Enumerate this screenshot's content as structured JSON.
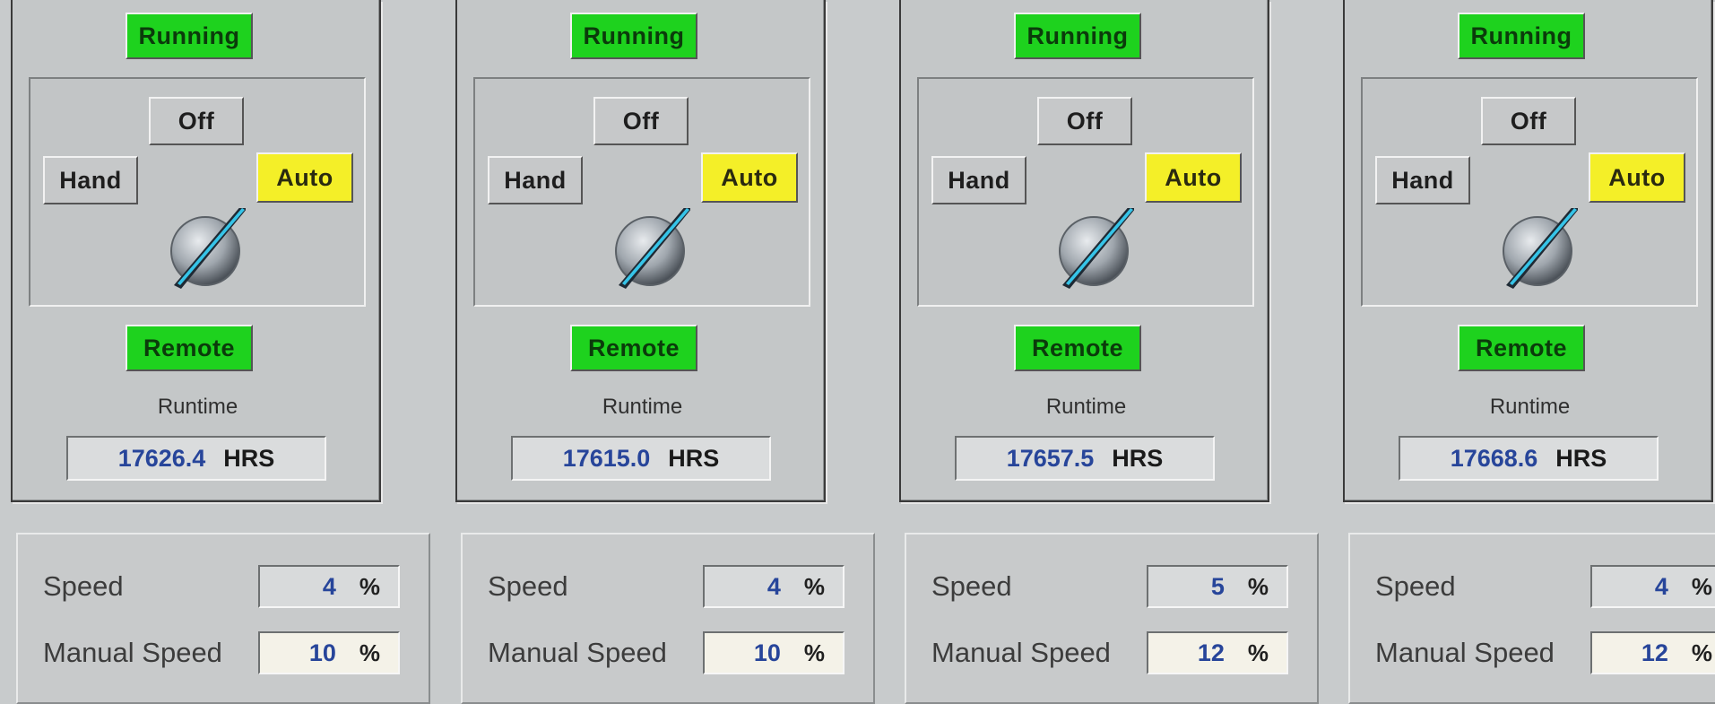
{
  "units": [
    {
      "status": "Running",
      "off": "Off",
      "hand": "Hand",
      "auto": "Auto",
      "remote": "Remote",
      "runtime_label": "Runtime",
      "runtime_value": "17626.4",
      "runtime_unit": "HRS",
      "speed_label": "Speed",
      "speed_value": "4",
      "speed_unit": "%",
      "manual_label": "Manual Speed",
      "manual_value": "10",
      "manual_unit": "%"
    },
    {
      "status": "Running",
      "off": "Off",
      "hand": "Hand",
      "auto": "Auto",
      "remote": "Remote",
      "runtime_label": "Runtime",
      "runtime_value": "17615.0",
      "runtime_unit": "HRS",
      "speed_label": "Speed",
      "speed_value": "4",
      "speed_unit": "%",
      "manual_label": "Manual Speed",
      "manual_value": "10",
      "manual_unit": "%"
    },
    {
      "status": "Running",
      "off": "Off",
      "hand": "Hand",
      "auto": "Auto",
      "remote": "Remote",
      "runtime_label": "Runtime",
      "runtime_value": "17657.5",
      "runtime_unit": "HRS",
      "speed_label": "Speed",
      "speed_value": "5",
      "speed_unit": "%",
      "manual_label": "Manual Speed",
      "manual_value": "12",
      "manual_unit": "%"
    },
    {
      "status": "Running",
      "off": "Off",
      "hand": "Hand",
      "auto": "Auto",
      "remote": "Remote",
      "runtime_label": "Runtime",
      "runtime_value": "17668.6",
      "runtime_unit": "HRS",
      "speed_label": "Speed",
      "speed_value": "4",
      "speed_unit": "%",
      "manual_label": "Manual Speed",
      "manual_value": "12",
      "manual_unit": "%"
    }
  ],
  "selected_mode": "Auto",
  "colors": {
    "running": "#1ed21e",
    "remote": "#1ed21e",
    "auto_selected": "#f4ef28",
    "value_text": "#27459a"
  },
  "icons": {
    "selector": "hand-off-auto-selector-knob-icon"
  }
}
